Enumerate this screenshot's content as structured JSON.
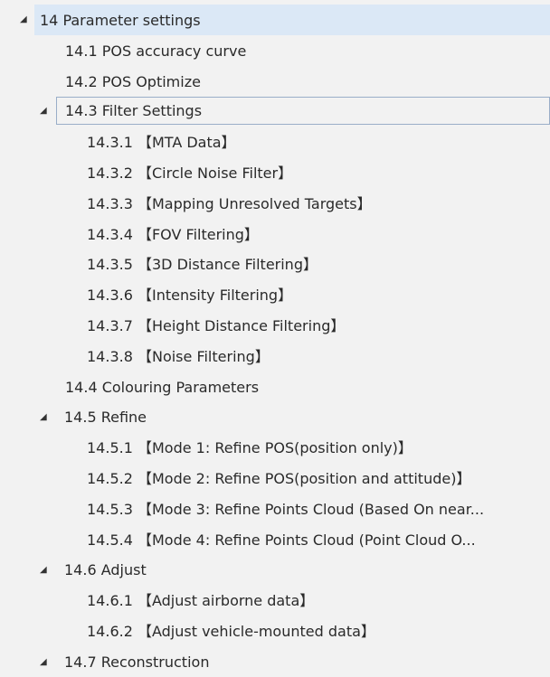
{
  "tree": {
    "items": [
      {
        "label": "14 Parameter settings",
        "arrow": "◢"
      },
      {
        "label": "14.1 POS accuracy curve"
      },
      {
        "label": "14.2 POS Optimize"
      },
      {
        "label": "14.3 Filter Settings",
        "arrow": "◢"
      },
      {
        "label": "14.3.1 【MTA Data】"
      },
      {
        "label": "14.3.2 【Circle Noise Filter】"
      },
      {
        "label": "14.3.3 【Mapping Unresolved Targets】"
      },
      {
        "label": "14.3.4 【FOV Filtering】"
      },
      {
        "label": "14.3.5 【3D Distance Filtering】"
      },
      {
        "label": "14.3.6 【Intensity Filtering】"
      },
      {
        "label": "14.3.7 【Height Distance Filtering】"
      },
      {
        "label": "14.3.8 【Noise Filtering】"
      },
      {
        "label": "14.4 Colouring Parameters"
      },
      {
        "label": "14.5 Refine",
        "arrow": "◢"
      },
      {
        "label": "14.5.1 【Mode 1: Refine POS(position only)】"
      },
      {
        "label": "14.5.2 【Mode 2: Refine POS(position and attitude)】"
      },
      {
        "label": "14.5.3 【Mode 3:  Refine Points Cloud (Based On near..."
      },
      {
        "label": "14.5.4 【Mode 4:  Refine Points Cloud  (Point Cloud O..."
      },
      {
        "label": "14.6 Adjust",
        "arrow": "◢"
      },
      {
        "label": "14.6.1 【Adjust airborne data】"
      },
      {
        "label": "14.6.2 【Adjust vehicle-mounted data】"
      },
      {
        "label": "14.7 Reconstruction",
        "arrow": "◢"
      }
    ]
  },
  "colors": {
    "background": "#f2f2f2",
    "selected_background": "#dbe8f6",
    "focus_border": "#9aaec8"
  }
}
